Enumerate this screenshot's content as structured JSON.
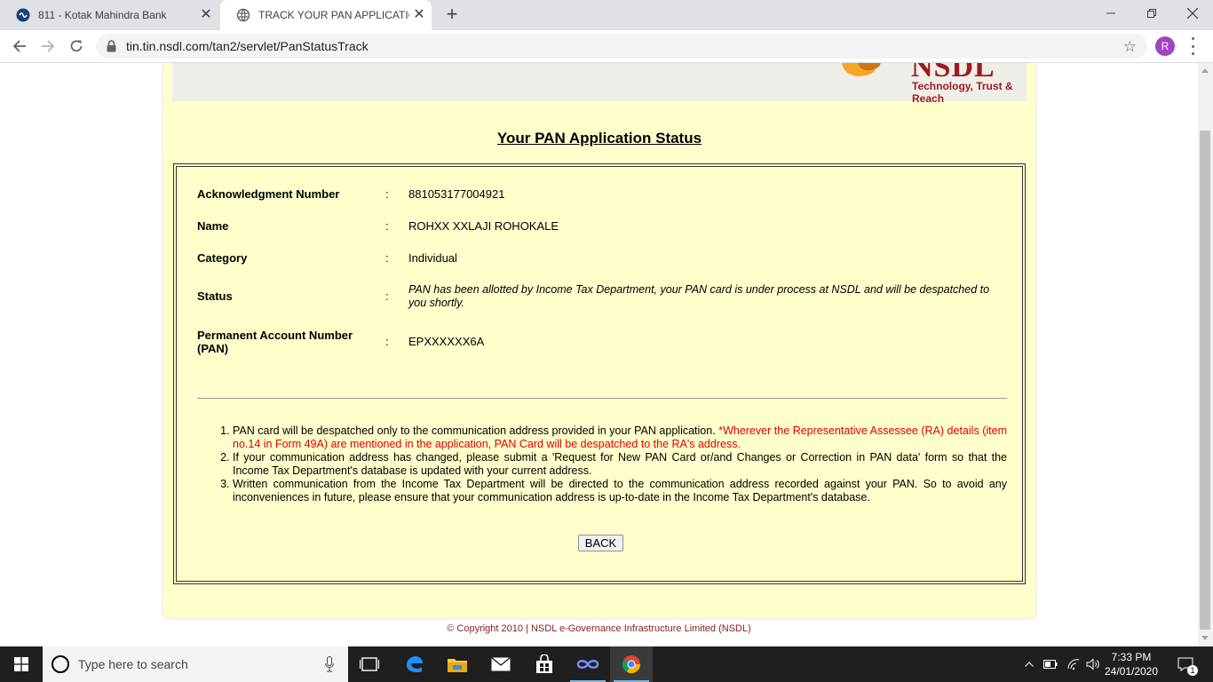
{
  "browser": {
    "tabs": [
      {
        "title": "811 - Kotak Mahindra Bank",
        "active": false
      },
      {
        "title": "TRACK YOUR PAN APPLICATION",
        "active": true
      }
    ],
    "url": "tin.tin.nsdl.com/tan2/servlet/PanStatusTrack",
    "profile_initial": "R"
  },
  "header": {
    "logo_text": "NSDL",
    "tagline": "Technology, Trust & Reach"
  },
  "page_title": "Your PAN Application Status",
  "details": [
    {
      "label": "Acknowledgment Number",
      "value": "881053177004921"
    },
    {
      "label": "Name",
      "value": "ROHXX XXLAJI ROHOKALE"
    },
    {
      "label": "Category",
      "value": "Individual"
    },
    {
      "label": "Status",
      "value": "PAN has been allotted by Income Tax Department, your PAN card is under process at NSDL and will be despatched to you shortly."
    },
    {
      "label": "Permanent Account Number (PAN)",
      "value": "EPXXXXXX6A"
    }
  ],
  "separator": ":",
  "notes": [
    {
      "text": "PAN card will be despatched only to the communication address provided in your PAN application. ",
      "highlight": "*Wherever the Representative Assessee (RA) details (item no.14 in Form 49A) are mentioned in the application, PAN Card will be despatched to the RA's address."
    },
    {
      "text": "If your communication address has changed, please submit a 'Request for New PAN Card or/and Changes or Correction in PAN data' form so that the Income Tax Department's database is updated with your current address."
    },
    {
      "text": "Written communication from the Income Tax Department will be directed to the communication address recorded against your PAN. So to avoid any inconveniences in future, please ensure that your communication address is up-to-date in the Income Tax Department's database."
    }
  ],
  "back_label": "BACK",
  "footer": "© Copyright 2010  |  NSDL e-Governance Infrastructure Limited (NSDL)",
  "taskbar": {
    "search_placeholder": "Type here to search",
    "time": "7:33 PM",
    "date": "24/01/2020",
    "notification_count": "1"
  },
  "colors": {
    "page_bg": "#ffffcc",
    "brand": "#9e1b20",
    "highlight": "#e00000"
  }
}
